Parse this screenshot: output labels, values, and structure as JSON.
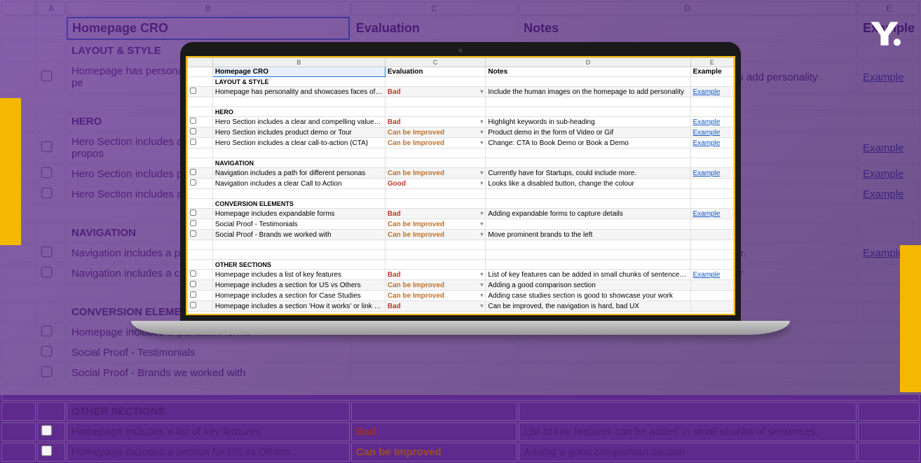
{
  "columns": [
    "A",
    "B",
    "C",
    "D",
    "E"
  ],
  "headers": {
    "b": "Homepage CRO",
    "c": "Evaluation",
    "d": "Notes",
    "e": "Example"
  },
  "link_label": "Example",
  "eval": {
    "bad": "Bad",
    "imp": "Can be Improved",
    "good": "Good"
  },
  "sections": {
    "layout": "LAYOUT & STYLE",
    "hero": "HERO",
    "nav": "NAVIGATION",
    "conv": "CONVERSION ELEMENTS",
    "other": "OTHER SECTIONS"
  },
  "rows": {
    "layout1": {
      "b": "Homepage has personality and showcases faces of real pe",
      "c": "bad",
      "d": "Include the human images on the homepage to add personality",
      "link": true
    },
    "hero1": {
      "b": "Hero Section includes a clear and compelling value propos",
      "c": "bad",
      "d": "Highlight keywords in sub-heading",
      "link": true
    },
    "hero2": {
      "b": "Hero Section includes product demo or Tour",
      "c": "imp",
      "d": "Product demo in the form of Video or Gif",
      "link": true
    },
    "hero3": {
      "b": "Hero Section includes a clear call-to-action (CTA)",
      "c": "imp",
      "d": "Change: CTA to Book Demo or Book a Demo",
      "link": true
    },
    "nav1": {
      "b": "Navigation includes a path for different personas",
      "c": "imp",
      "d": "Currently have for Startups, could include more.",
      "link": true
    },
    "nav2": {
      "b": "Navigation includes a clear Call to Action",
      "c": "good",
      "d": "Looks like a disabled button, change the colour",
      "link": false
    },
    "conv1": {
      "b": "Homepage includes expandable forms",
      "c": "bad",
      "d": "Adding expandable forms to capture details",
      "link": true
    },
    "conv2": {
      "b": "Social Proof - Testimonials",
      "c": "imp",
      "d": "",
      "link": false
    },
    "conv3": {
      "b": "Social Proof - Brands we worked with",
      "c": "imp",
      "d": "Move prominent brands to the left",
      "link": false
    },
    "other1": {
      "b": "Homepage includes a list of key features",
      "c": "bad",
      "d": "List of key features can be added in small chunks of sentences, that i",
      "link": true
    },
    "other2": {
      "b": "Homepage includes a section for US vs Others",
      "c": "imp",
      "d": "Adding a good comparison section",
      "link": false
    },
    "other3": {
      "b": "Homepage includes a section for Case Studies",
      "c": "imp",
      "d": "Adding case studies section is good to showcase your work",
      "link": false
    },
    "other4": {
      "b": "Homepage includes a section 'How it works' or link to a pa",
      "c": "bad",
      "d": "Can be improved, the navigation is hard, bad UX",
      "link": false
    }
  },
  "bg": {
    "layout1_d": "Include the human images on the homepage to add personality",
    "hero3_d": "Change: CTA to Book Demo or Book a Demo",
    "nav1_d": "Currently have for Startups, could include more.",
    "nav2_d": "Looks like a disabled button, change the colour",
    "other1_d": "List of key features can be added in small chunks of sentences,",
    "other2_d": "Adding a good comparison section"
  }
}
